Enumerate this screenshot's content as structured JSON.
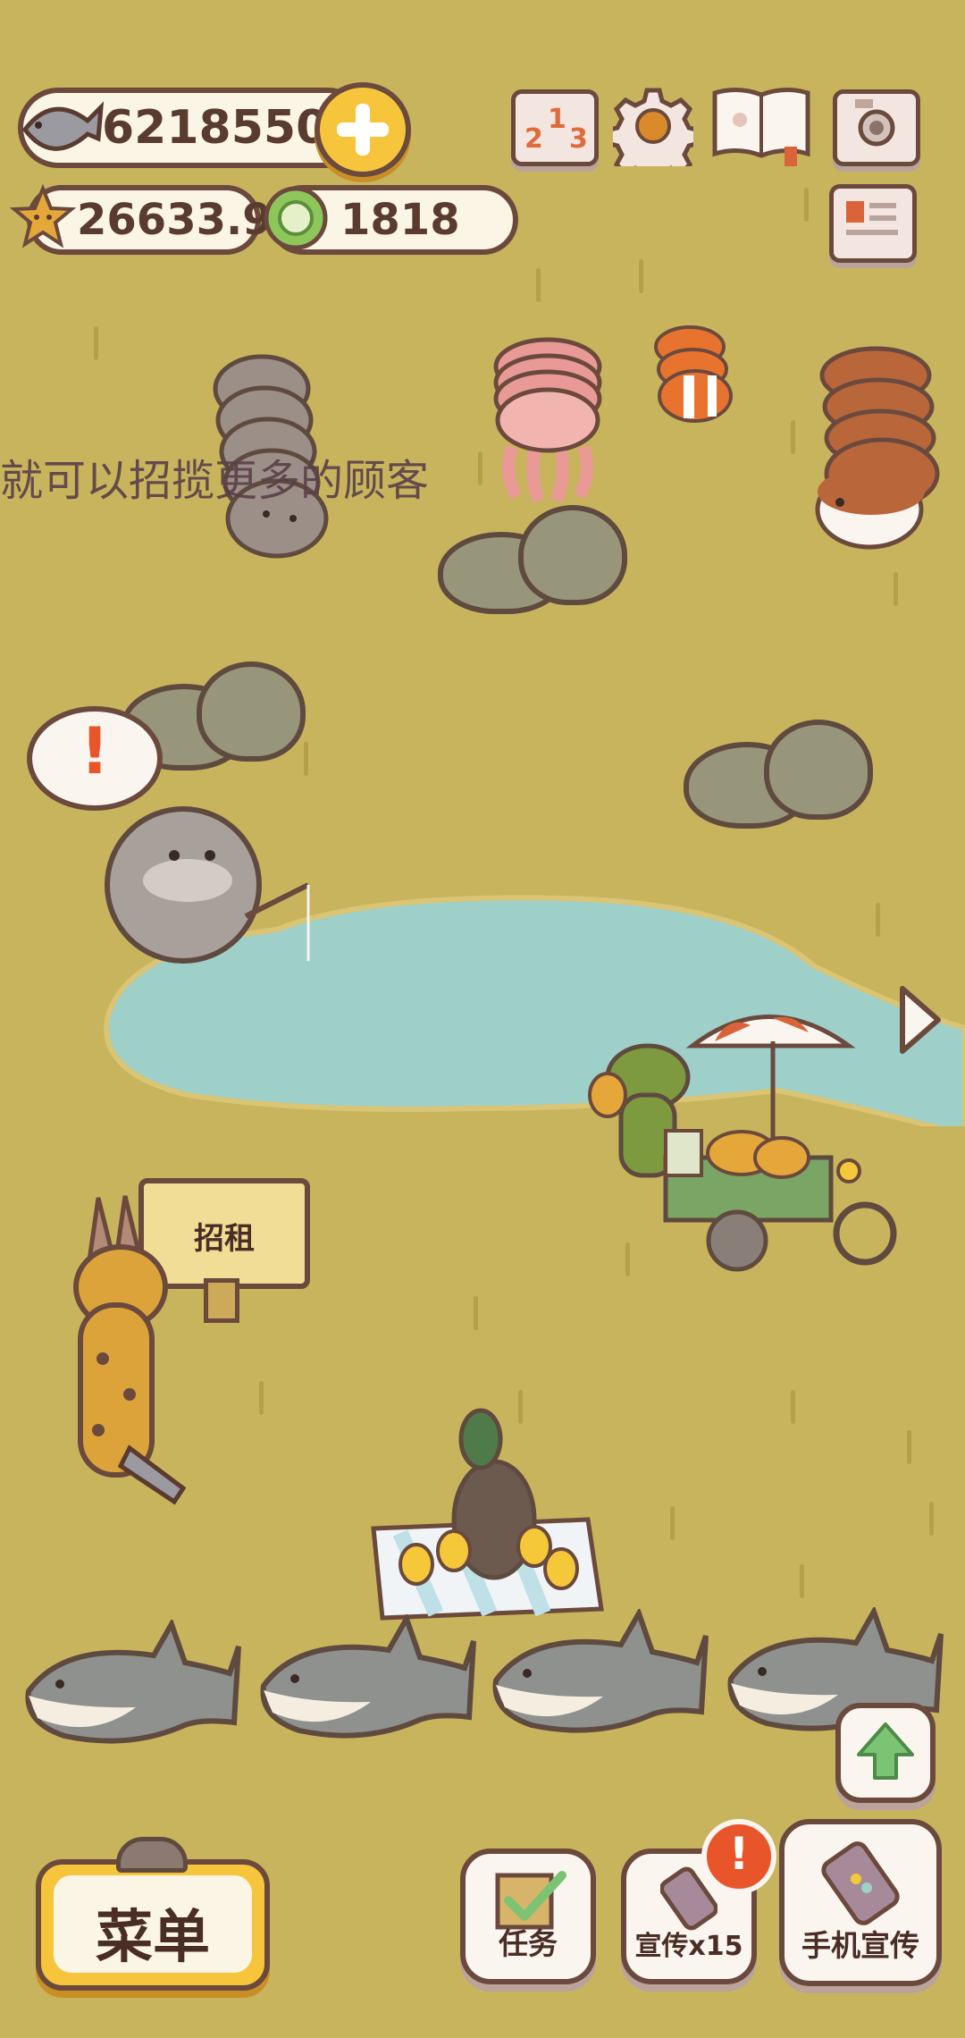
{
  "currencies": {
    "fish": "62185501",
    "stars": "26633.9",
    "coins": "1818"
  },
  "top_buttons": {
    "ranking_digits": [
      "2",
      "1",
      "3"
    ]
  },
  "hint_text": "就可以招揽更多的顾客",
  "sign": {
    "label": "招租"
  },
  "bottom_bar": {
    "menu_label": "菜单",
    "tasks_label": "任务",
    "promo_label": "宣传x15",
    "phone_promo_label": "手机宣传",
    "alert_mark": "!"
  },
  "speech_bubble": {
    "mark": "!"
  },
  "colors": {
    "background": "#c8b45c",
    "pond": "#9fcfc9",
    "outline": "#6b4a3d",
    "gold": "#f5c83a",
    "alert": "#e8552a"
  },
  "icons": [
    "fish-icon",
    "plus-icon",
    "star-icon",
    "coin-icon",
    "ranking-icon",
    "gear-icon",
    "guide-book-icon",
    "camera-icon",
    "newspaper-icon",
    "arrow-right-icon",
    "arrow-up-icon",
    "checklist-icon",
    "phone-icon"
  ]
}
